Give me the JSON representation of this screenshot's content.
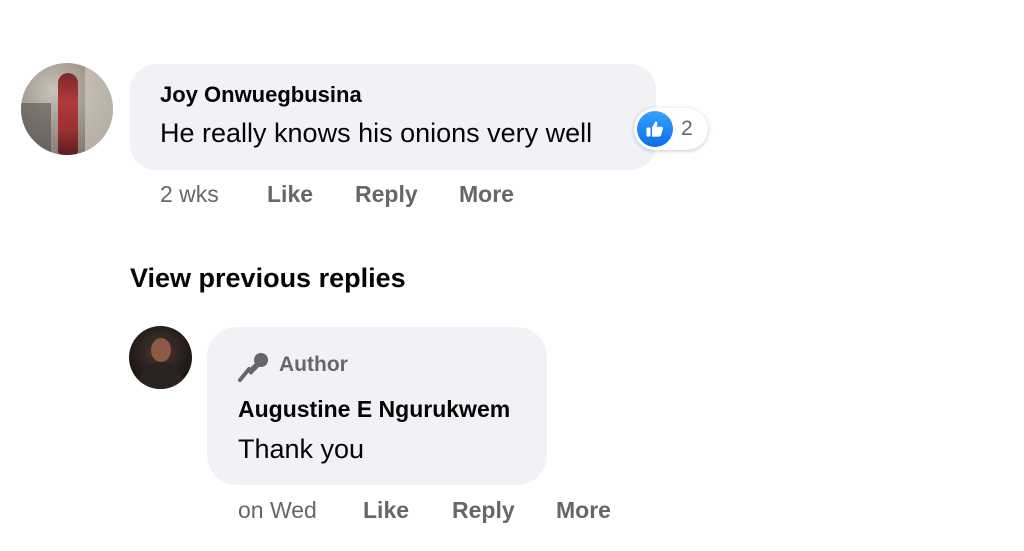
{
  "comments": [
    {
      "author": "Joy Onwuegbusina",
      "text": "He really knows his onions very well",
      "reaction_count": "2",
      "time": "2 wks",
      "actions": {
        "like": "Like",
        "reply": "Reply",
        "more": "More"
      }
    }
  ],
  "view_previous": "View previous replies",
  "reply": {
    "badge": "Author",
    "author": "Augustine E Ngurukwem",
    "text": "Thank you",
    "time": "on Wed",
    "actions": {
      "like": "Like",
      "reply": "Reply",
      "more": "More"
    }
  },
  "colors": {
    "bubble": "#f0f2f5",
    "meta_text": "#65676b",
    "like_blue": "#0a6ee8"
  },
  "icons": {
    "reaction": "like-thumbs-up-icon",
    "author_badge": "microphone-icon"
  }
}
